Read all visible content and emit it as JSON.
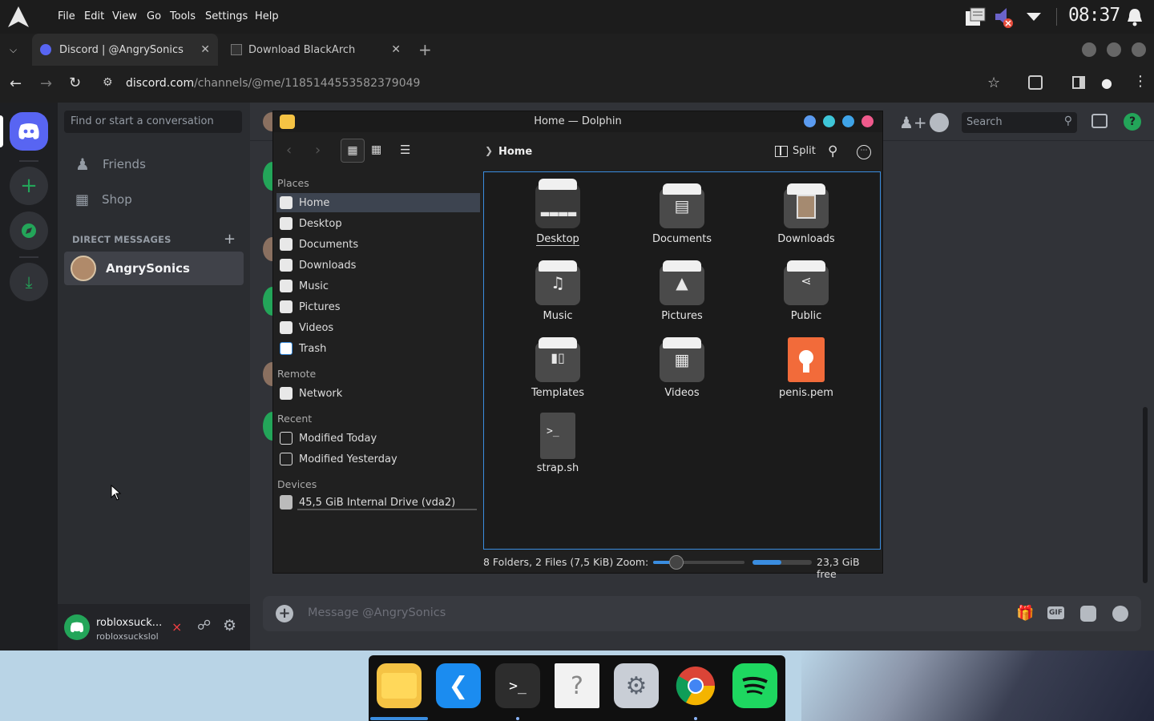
{
  "topbar": {
    "menus": [
      "File",
      "Edit",
      "View",
      "Go",
      "Tools",
      "Settings",
      "Help"
    ],
    "clock": "08:37"
  },
  "browser": {
    "tabs": [
      {
        "label": "Discord | @AngrySonics"
      },
      {
        "label": "Download BlackArch"
      }
    ],
    "url_domain": "discord.com",
    "url_path": "/channels/@me/1185144553582379049"
  },
  "discord": {
    "search_placeholder": "Find or start a conversation",
    "nav": {
      "friends": "Friends",
      "shop": "Shop"
    },
    "dm_header": "DIRECT MESSAGES",
    "dm_add": "+",
    "dms": [
      {
        "name": "AngrySonics"
      }
    ],
    "user": {
      "display": "robloxsuck...",
      "username": "robloxsuckslol"
    },
    "header_search": "Search",
    "message_placeholder": "Message @AngrySonics",
    "gif_label": "GIF"
  },
  "dolphin": {
    "title": "Home — Dolphin",
    "breadcrumb": "Home",
    "split_label": "Split",
    "sections": {
      "places": "Places",
      "remote": "Remote",
      "recent": "Recent",
      "devices": "Devices"
    },
    "places": [
      "Home",
      "Desktop",
      "Documents",
      "Downloads",
      "Music",
      "Pictures",
      "Videos",
      "Trash"
    ],
    "remote": [
      "Network"
    ],
    "recent": [
      "Modified Today",
      "Modified Yesterday"
    ],
    "devices": [
      "45,5 GiB Internal Drive (vda2)"
    ],
    "items": [
      {
        "name": "Desktop"
      },
      {
        "name": "Documents"
      },
      {
        "name": "Downloads"
      },
      {
        "name": "Music"
      },
      {
        "name": "Pictures"
      },
      {
        "name": "Public"
      },
      {
        "name": "Templates"
      },
      {
        "name": "Videos"
      },
      {
        "name": "penis.pem"
      },
      {
        "name": "strap.sh"
      }
    ],
    "status": "8 Folders, 2 Files (7,5 KiB)",
    "zoom_label": "Zoom:",
    "zoom_level": 0.25,
    "disk_used_fraction": 0.48,
    "free_space": "23,3 GiB free"
  },
  "dock": {
    "apps": [
      "files-icon",
      "vscode-icon",
      "terminal-icon",
      "unknown-file-icon",
      "settings-icon",
      "chrome-icon",
      "spotify-icon"
    ]
  }
}
